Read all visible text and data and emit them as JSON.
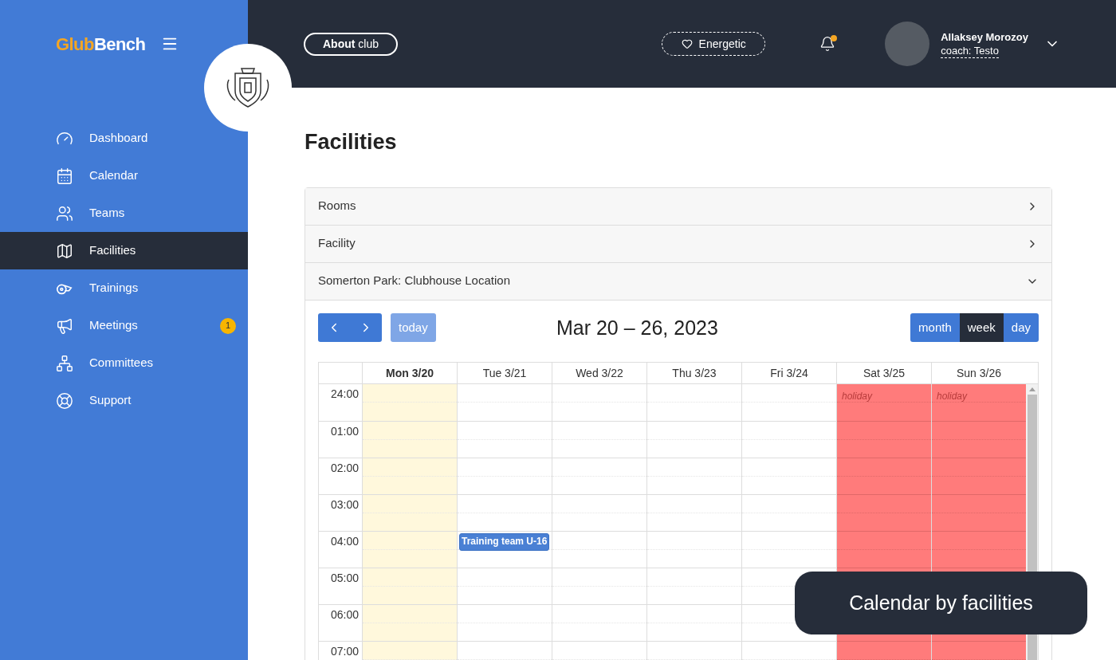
{
  "brand": {
    "first": "Glub",
    "second": "Bench"
  },
  "sidebar": {
    "items": [
      {
        "label": "Dashboard",
        "selected": false
      },
      {
        "label": "Calendar",
        "selected": false
      },
      {
        "label": "Teams",
        "selected": false
      },
      {
        "label": "Facilities",
        "selected": true
      },
      {
        "label": "Trainings",
        "selected": false
      },
      {
        "label": "Meetings",
        "selected": false,
        "badge": "1"
      },
      {
        "label": "Committees",
        "selected": false
      },
      {
        "label": "Support",
        "selected": false
      }
    ]
  },
  "header": {
    "about_button": "**About** club",
    "mood": "Energetic",
    "notifications": {
      "unread": true
    },
    "user": {
      "name": "Allaksey Morozoy",
      "role": "coach: Testo"
    }
  },
  "page": {
    "title": "Facilities"
  },
  "accordion": [
    {
      "label": "Rooms",
      "expanded": false
    },
    {
      "label": "Facility",
      "expanded": false
    },
    {
      "label": "Somerton Park: Clubhouse Location",
      "expanded": true
    }
  ],
  "calendar": {
    "today_button": "today",
    "range_title": "Mar 20 – 26, 2023",
    "views": [
      {
        "label": "month",
        "selected": false
      },
      {
        "label": "week",
        "selected": true
      },
      {
        "label": "day",
        "selected": false
      }
    ],
    "days": [
      {
        "label": "Mon 3/20",
        "today": true,
        "holiday": false
      },
      {
        "label": "Tue 3/21",
        "today": false,
        "holiday": false,
        "slots": [
          {
            "booked": false
          },
          {
            "booked": false
          },
          {
            "booked": false
          },
          {
            "booked": false
          },
          {
            "booked": true,
            "title": "Training team U-16"
          },
          {
            "booked": false
          },
          {
            "booked": false
          },
          {
            "booked": false
          }
        ]
      },
      {
        "label": "Wed 3/22",
        "today": false,
        "holiday": false
      },
      {
        "label": "Thu 3/23",
        "today": false,
        "holiday": false
      },
      {
        "label": "Fri 3/24",
        "today": false,
        "holiday": false
      },
      {
        "label": "Sat 3/25",
        "today": false,
        "holiday": true,
        "note": "holiday"
      },
      {
        "label": "Sun 3/26",
        "today": false,
        "holiday": true,
        "note": "holiday"
      }
    ],
    "times": [
      "24:00",
      "01:00",
      "02:00",
      "03:00",
      "04:00",
      "05:00",
      "06:00",
      "07:00"
    ]
  },
  "toast": "Calendar by facilities"
}
